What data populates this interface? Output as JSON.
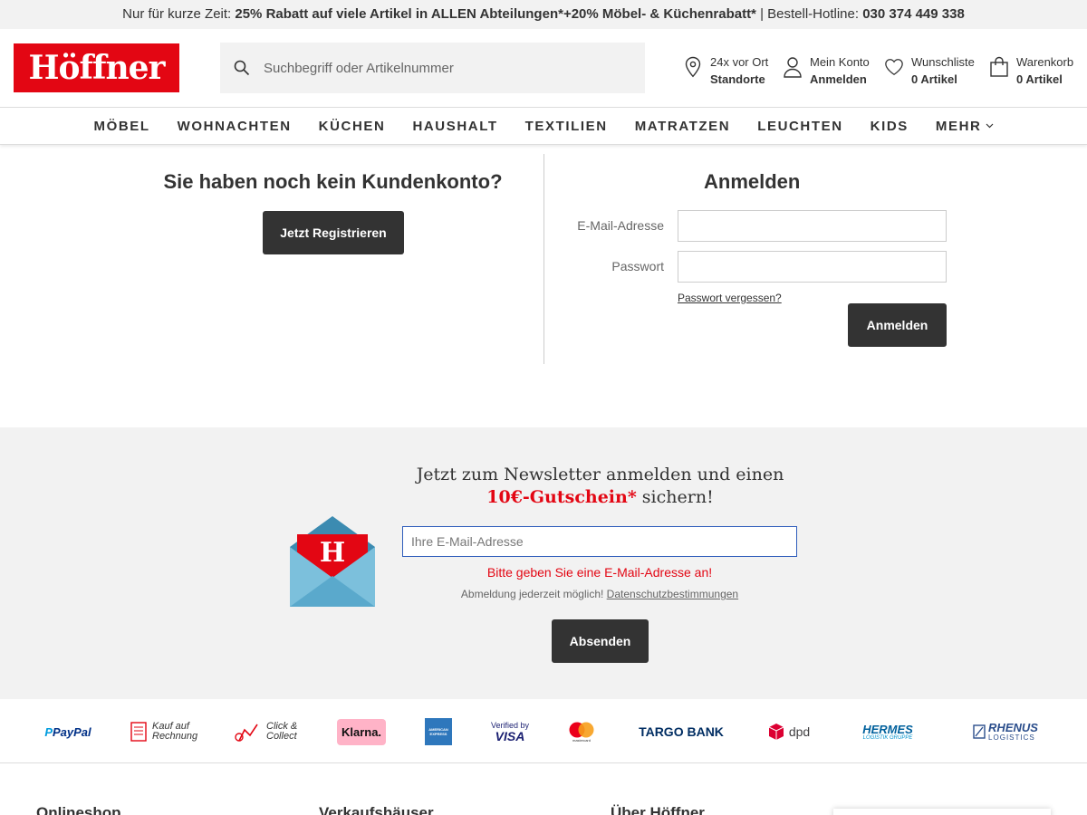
{
  "promo": {
    "prefix": "Nur für kurze Zeit: ",
    "bold1": "25% Rabatt auf viele Artikel in ALLEN Abteilungen*+20% Möbel- & Küchenrabatt*",
    "separator": " | Bestell-Hotline: ",
    "hotline": "030 374 449 338"
  },
  "header": {
    "logo": "Höffner",
    "search_placeholder": "Suchbegriff oder Artikelnummer",
    "stores_line1": "24x vor Ort",
    "stores_line2": "Standorte",
    "account_line1": "Mein Konto",
    "account_line2": "Anmelden",
    "wishlist_line1": "Wunschliste",
    "wishlist_line2": "0 Artikel",
    "cart_line1": "Warenkorb",
    "cart_line2": "0 Artikel"
  },
  "nav": {
    "items": [
      "MÖBEL",
      "WOHNACHTEN",
      "KÜCHEN",
      "HAUSHALT",
      "TEXTILIEN",
      "MATRATZEN",
      "LEUCHTEN",
      "KIDS"
    ],
    "more": "MEHR"
  },
  "register": {
    "title": "Sie haben noch kein Kundenkonto?",
    "button": "Jetzt Registrieren"
  },
  "login": {
    "title": "Anmelden",
    "email_label": "E-Mail-Adresse",
    "password_label": "Passwort",
    "forgot": "Passwort vergessen?",
    "button": "Anmelden"
  },
  "newsletter": {
    "line1": "Jetzt zum Newsletter anmelden und einen",
    "highlight": "10€-Gutschein*",
    "line2_suffix": " sichern!",
    "placeholder": "Ihre E-Mail-Adresse",
    "error": "Bitte geben Sie eine E-Mail-Adresse an!",
    "note": "Abmeldung jederzeit möglich! ",
    "privacy_link": "Datenschutzbestimmungen",
    "button": "Absenden",
    "envelope_letter": "H"
  },
  "payments": {
    "paypal": "PayPal",
    "invoice": "Kauf auf Rechnung",
    "click_collect": "Click & Collect",
    "klarna": "Klarna.",
    "amex": "AMERICAN EXPRESS",
    "visa_top": "Verified by",
    "visa": "VISA",
    "mastercard": "mastercard",
    "targobank": "TARGO BANK",
    "dpd": "dpd",
    "hermes": "HERMES",
    "hermes_sub": "LOGISTIK GRUPPE",
    "rhenus": "RHENUS",
    "rhenus_sub": "LOGISTICS"
  },
  "footer": {
    "col1": "Onlineshop",
    "col2": "Verkaufshäuser",
    "col3": "Über Höffner"
  },
  "colors": {
    "brand_red": "#e30613",
    "dark_button": "#333333",
    "input_focus": "#2f5dbb"
  }
}
